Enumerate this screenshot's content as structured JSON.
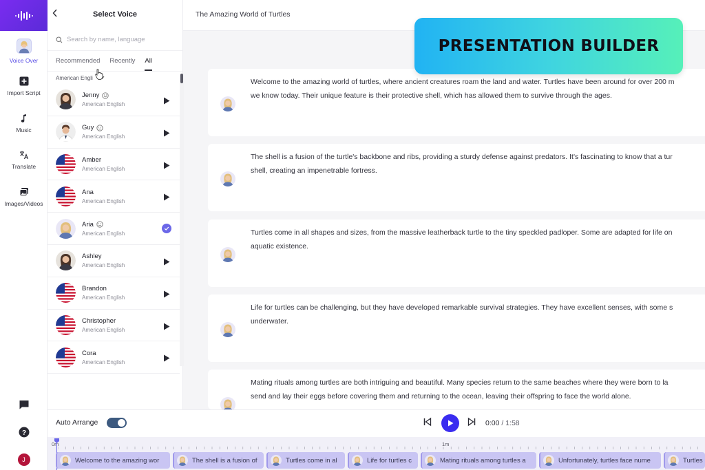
{
  "rail": {
    "items": [
      {
        "label": "Voice Over"
      },
      {
        "label": "Import Script"
      },
      {
        "label": "Music"
      },
      {
        "label": "Translate"
      },
      {
        "label": "Images/Videos"
      }
    ],
    "user_initial": "J"
  },
  "voice_panel": {
    "title": "Select Voice",
    "search_placeholder": "Search by name, language",
    "tabs": [
      "Recommended",
      "Recently",
      "All"
    ],
    "active_tab": "All",
    "accent_filter": "American Engli",
    "voices": [
      {
        "name": "Jenny",
        "accent": "American English",
        "avatar": "woman-photo",
        "smiley": true,
        "selected": false
      },
      {
        "name": "Guy",
        "accent": "American English",
        "avatar": "man-photo",
        "smiley": true,
        "selected": false
      },
      {
        "name": "Amber",
        "accent": "American English",
        "avatar": "us-flag",
        "smiley": false,
        "selected": false
      },
      {
        "name": "Ana",
        "accent": "American English",
        "avatar": "us-flag",
        "smiley": false,
        "selected": false
      },
      {
        "name": "Aria",
        "accent": "American English",
        "avatar": "woman-photo-blonde",
        "smiley": true,
        "selected": true
      },
      {
        "name": "Ashley",
        "accent": "American English",
        "avatar": "woman-photo",
        "smiley": false,
        "selected": false
      },
      {
        "name": "Brandon",
        "accent": "American English",
        "avatar": "us-flag",
        "smiley": false,
        "selected": false
      },
      {
        "name": "Christopher",
        "accent": "American English",
        "avatar": "us-flag",
        "smiley": false,
        "selected": false
      },
      {
        "name": "Cora",
        "accent": "American English",
        "avatar": "us-flag",
        "smiley": false,
        "selected": false
      }
    ]
  },
  "doc": {
    "title": "The Amazing World of Turtles"
  },
  "banner": {
    "text": "PRESENTATION BUILDER"
  },
  "script_blocks": [
    {
      "text": "Welcome to the amazing world of turtles, where ancient creatures roam the land and water. Turtles have been around for over 200 m\nwe know today. Their unique feature is their protective shell, which has allowed them to survive through the ages."
    },
    {
      "text": "The shell is a fusion of the turtle's backbone and ribs, providing a sturdy defense against predators. It's fascinating to know that a tur\nshell, creating an impenetrable fortress."
    },
    {
      "text": "Turtles come in all shapes and sizes, from the massive leatherback turtle to the tiny speckled padloper. Some are adapted for life on\naquatic existence."
    },
    {
      "text": "Life for turtles can be challenging, but they have developed remarkable survival strategies. They have excellent senses, with some s\nunderwater."
    },
    {
      "text": "Mating rituals among turtles are both intriguing and beautiful. Many species return to the same beaches where they were born to la\nsend and lay their eggs before covering them and returning to the ocean, leaving their offspring to face the world alone."
    }
  ],
  "player": {
    "auto_arrange_label": "Auto Arrange",
    "auto_arrange_on": true,
    "current_time": "0:00",
    "separator": " / ",
    "total_time": "1:58"
  },
  "timeline": {
    "tick_labels": [
      "0m",
      "1m"
    ],
    "clips": [
      {
        "label": "Welcome to the amazing wor"
      },
      {
        "label": "The shell is a fusion of"
      },
      {
        "label": "Turtles come in al"
      },
      {
        "label": "Life for turtles c"
      },
      {
        "label": "Mating rituals among turtles a"
      },
      {
        "label": "Unfortunately, turtles face nume"
      },
      {
        "label": "Turtles"
      }
    ]
  },
  "colors": {
    "accent": "#3a2cf0",
    "check": "#6b67e8",
    "clip": "#c9c5f3",
    "toggle": "#3d5a80"
  }
}
